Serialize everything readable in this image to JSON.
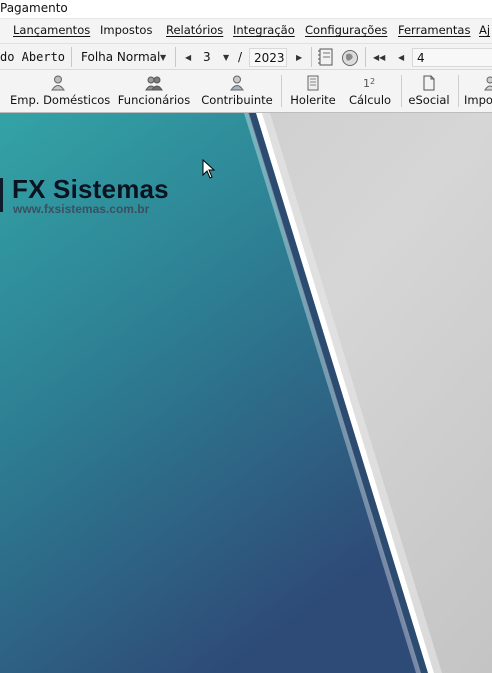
{
  "window": {
    "title": "Pagamento"
  },
  "menu": {
    "items": [
      "Lançamentos",
      "Impostos",
      "Relatórios",
      "Integração",
      "Configurações",
      "Ferramentas",
      "Aj"
    ]
  },
  "toolbar1": {
    "status": "do Aberto",
    "folha": "Folha Normal",
    "month": "3",
    "separator": "/",
    "year": "2023",
    "record": "4"
  },
  "toolbar2": {
    "buttons": [
      "Emp. Domésticos",
      "Funcionários",
      "Contribuinte",
      "Holerite",
      "Cálculo",
      "eSocial",
      "Impo"
    ]
  },
  "brand": {
    "name": "FX Sistemas",
    "url": "www.fxsistemas.com.br"
  },
  "colors": {
    "teal": "#2f9ea3",
    "navy": "#2f4e7c",
    "gray_panel": "#d3d3d3"
  }
}
